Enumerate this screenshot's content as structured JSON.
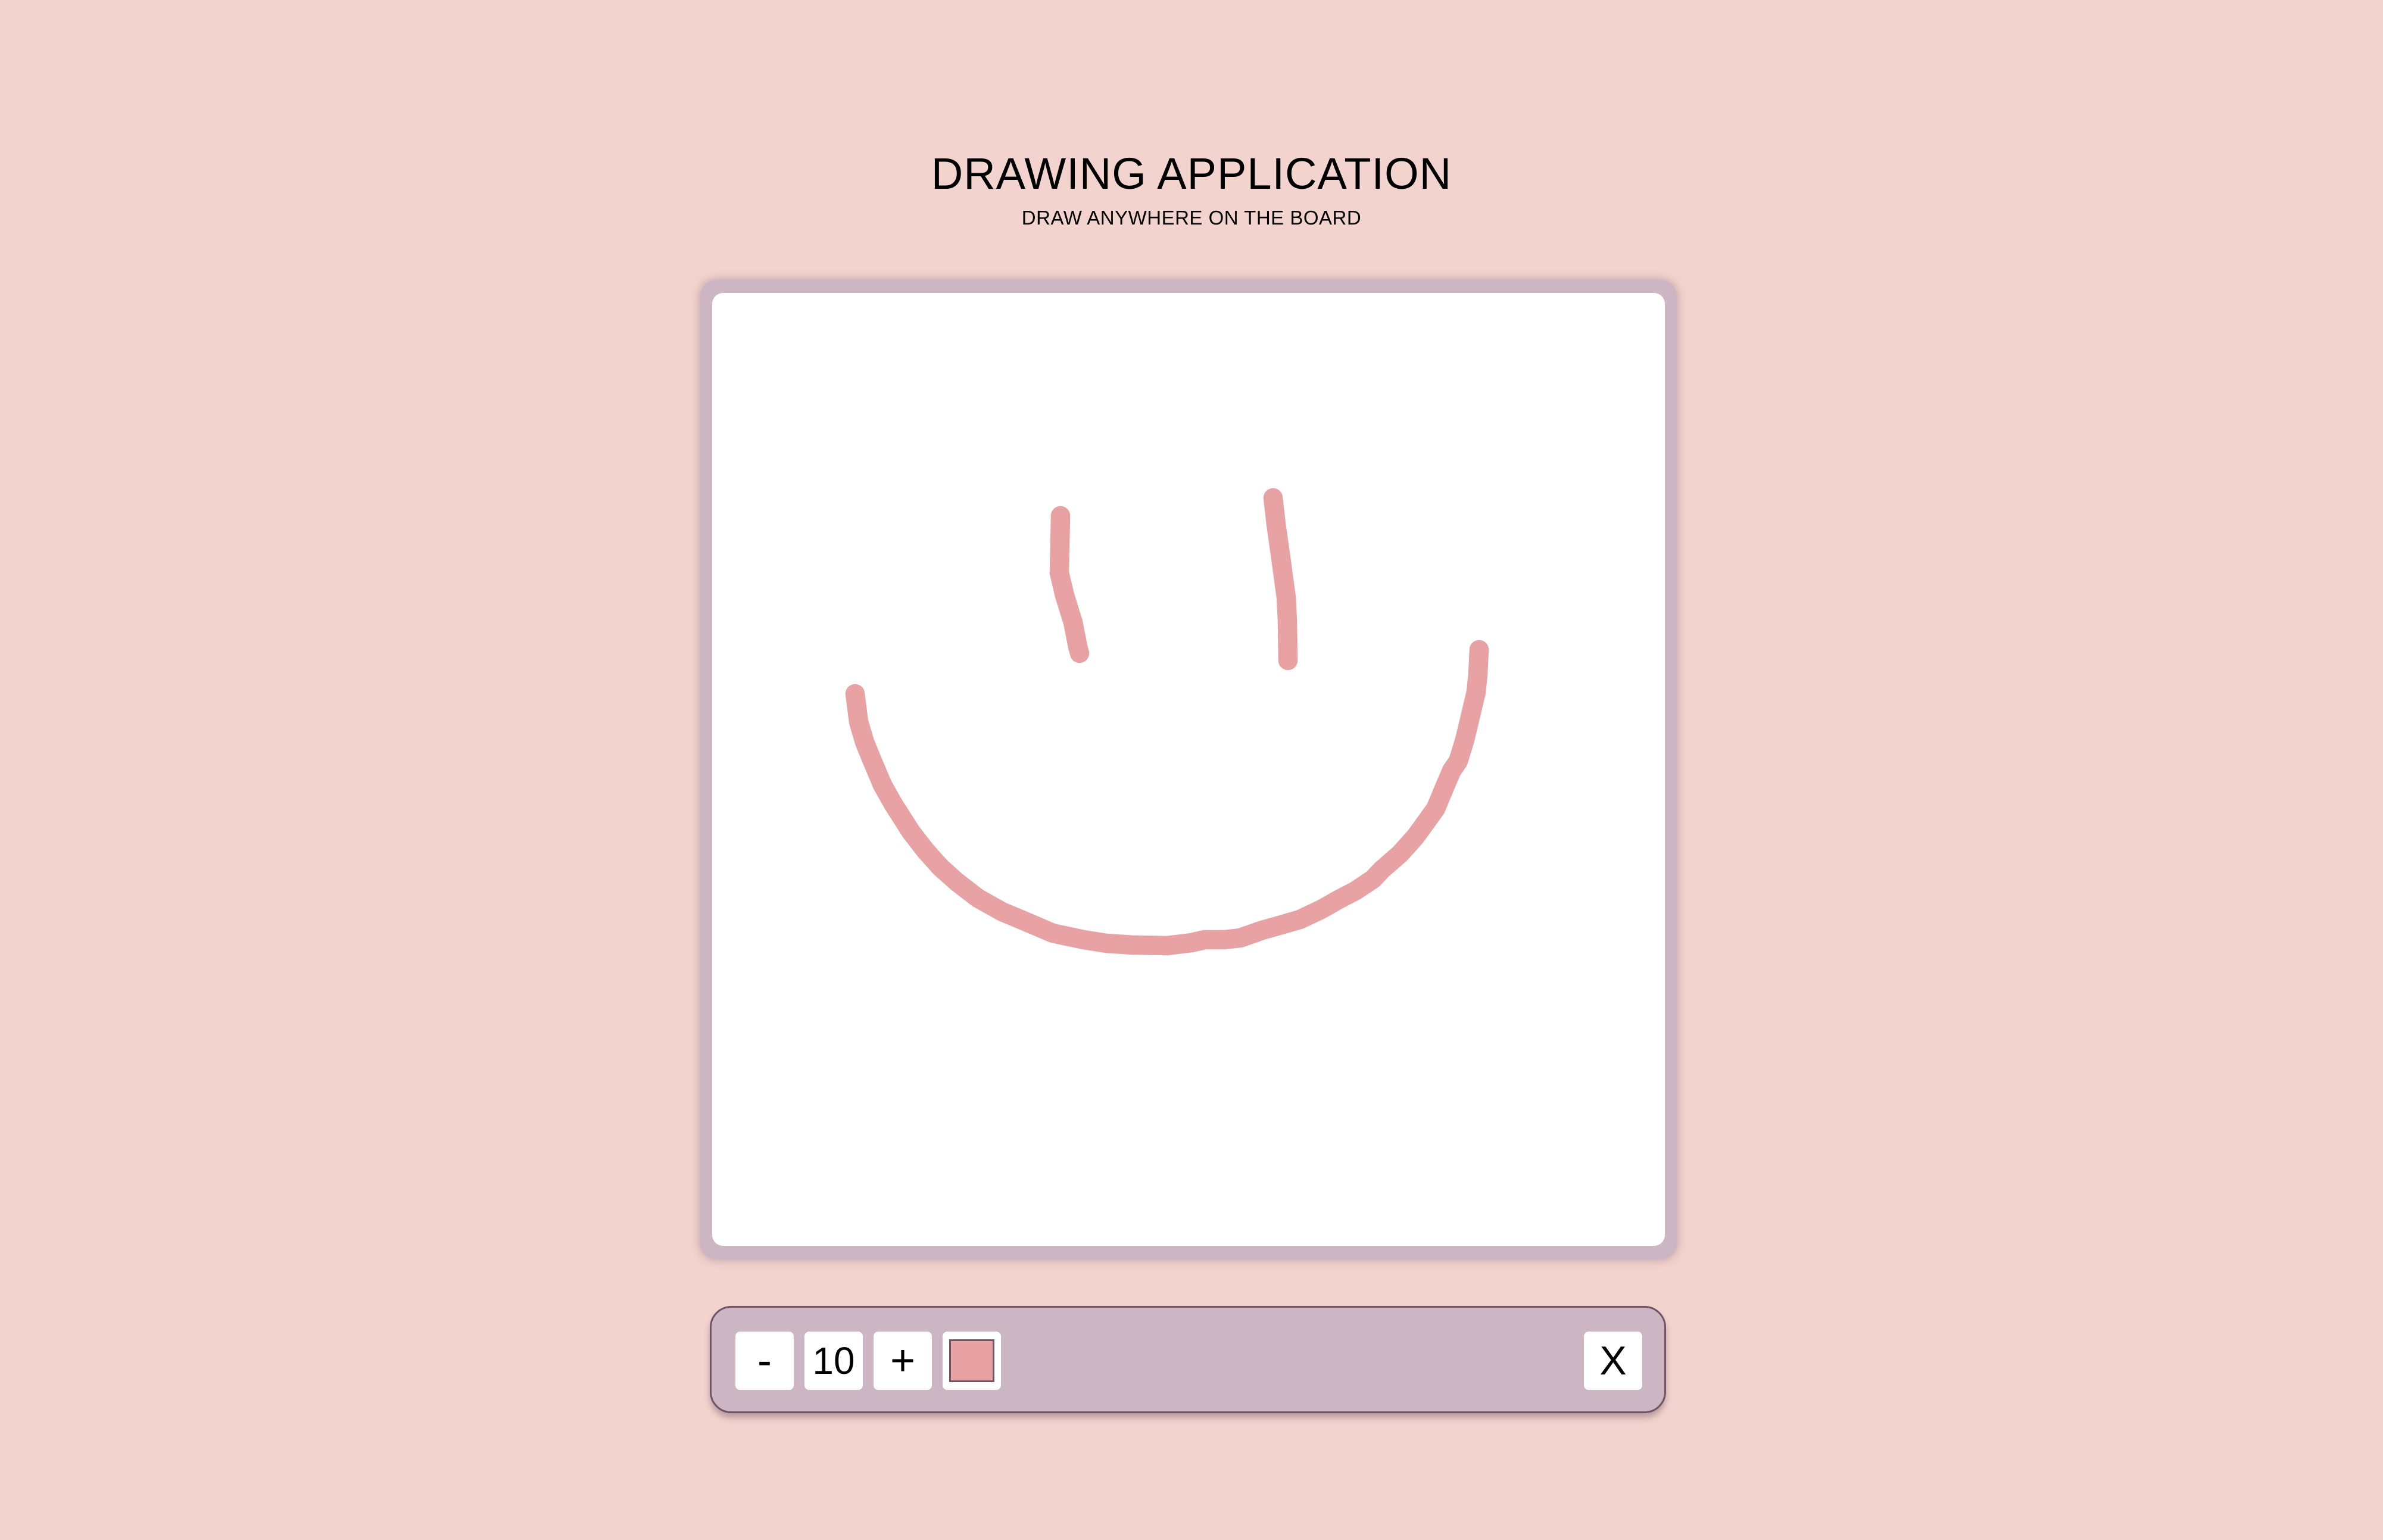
{
  "header": {
    "title": "DRAWING APPLICATION",
    "subtitle": "DRAW ANYWHERE ON THE BOARD"
  },
  "toolbar": {
    "decrease_label": "-",
    "brush_size": "10",
    "increase_label": "+",
    "clear_label": "X",
    "selected_color": "#e8a2a3"
  },
  "colors": {
    "background": "#f2d3ce",
    "frame": "#cdb6c4",
    "canvas": "#ffffff",
    "stroke": "#e8a2a3"
  }
}
